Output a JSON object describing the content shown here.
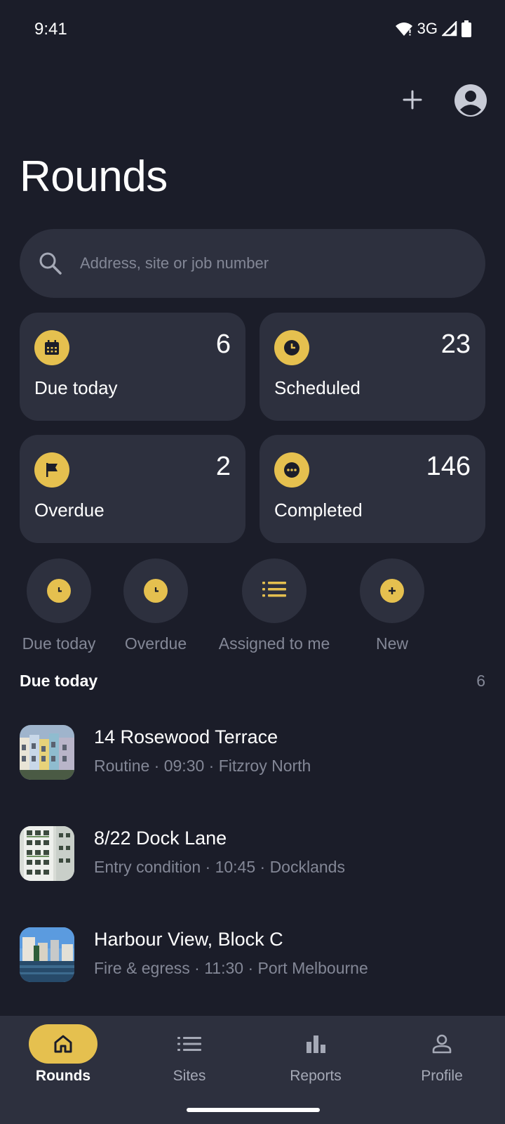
{
  "status_bar": {
    "time": "9:41",
    "network": "3G"
  },
  "header": {
    "title": "Rounds"
  },
  "search": {
    "placeholder": "Address, site or job number"
  },
  "stats": [
    {
      "label": "Due today",
      "count": "6",
      "icon": "calendar-icon"
    },
    {
      "label": "Scheduled",
      "count": "23",
      "icon": "clock-icon"
    },
    {
      "label": "Overdue",
      "count": "2",
      "icon": "flag-icon"
    },
    {
      "label": "Completed",
      "count": "146",
      "icon": "more-horizontal-icon"
    }
  ],
  "quick_filters": [
    {
      "label": "Due today",
      "icon": "clock-icon"
    },
    {
      "label": "Overdue",
      "icon": "clock-icon"
    },
    {
      "label": "Assigned to me",
      "icon": "list-icon"
    },
    {
      "label": "New",
      "icon": "plus-circle-icon"
    }
  ],
  "section": {
    "title": "Due today",
    "count": "6"
  },
  "rounds": [
    {
      "title": "14 Rosewood Terrace",
      "subtitle": "Routine · 09:30 · Fitzroy North"
    },
    {
      "title": "8/22 Dock Lane",
      "subtitle": "Entry condition · 10:45 · Docklands"
    },
    {
      "title": "Harbour View, Block C",
      "subtitle": "Fire & egress · 11:30 · Port Melbourne"
    }
  ],
  "bottom_nav": [
    {
      "label": "Rounds",
      "icon": "home-icon",
      "active": true
    },
    {
      "label": "Sites",
      "icon": "list-icon",
      "active": false
    },
    {
      "label": "Reports",
      "icon": "bar-chart-icon",
      "active": false
    },
    {
      "label": "Profile",
      "icon": "person-icon",
      "active": false
    }
  ],
  "colors": {
    "background": "#1b1d29",
    "surface": "#2d303e",
    "accent": "#e5c04f",
    "muted_text": "#838796"
  }
}
